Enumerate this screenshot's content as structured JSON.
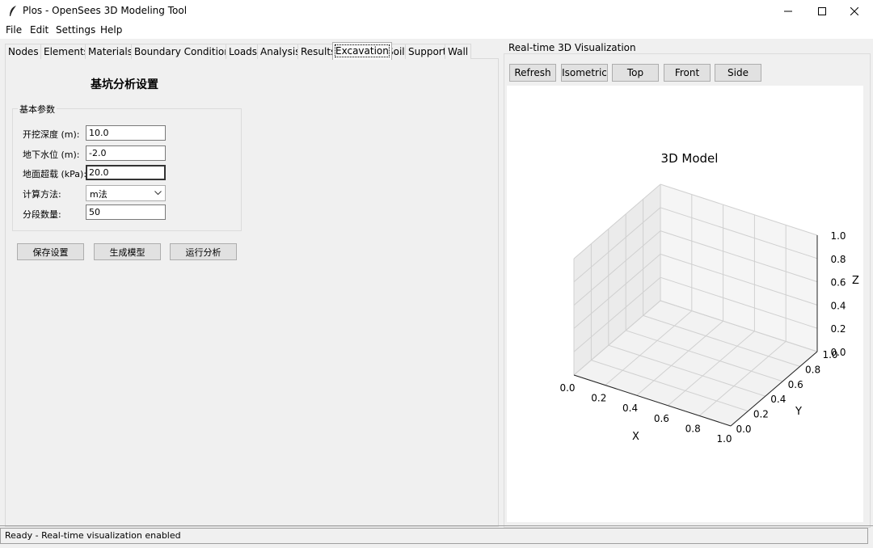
{
  "window": {
    "title": "Plos - OpenSees 3D Modeling Tool",
    "minimize": "–",
    "maximize": "□",
    "close": "✕"
  },
  "menu": [
    "File",
    "Edit",
    "Settings",
    "Help"
  ],
  "tabs": [
    "Nodes",
    "Elements",
    "Materials",
    "Boundary Conditions",
    "Loads",
    "Analysis",
    "Results",
    "Excavation",
    "Soil",
    "Support",
    "Wall"
  ],
  "active_tab": "Excavation",
  "excavation": {
    "heading": "基坑分析设置",
    "group_title": "基本参数",
    "params": [
      {
        "label": "开挖深度 (m):",
        "value": "10.0"
      },
      {
        "label": "地下水位 (m):",
        "value": "-2.0"
      },
      {
        "label": "地面超载 (kPa):",
        "value": "20.0"
      }
    ],
    "method_label": "计算方法:",
    "method_value": "m法",
    "segments_label": "分段数量:",
    "segments_value": "50",
    "buttons": {
      "save": "保存设置",
      "generate": "生成模型",
      "run": "运行分析"
    }
  },
  "visualization": {
    "frame_title": "Real-time 3D Visualization",
    "buttons": [
      "Refresh",
      "Isometric",
      "Top",
      "Front",
      "Side"
    ]
  },
  "chart_data": {
    "type": "scatter",
    "title": "3D Model",
    "xlabel": "X",
    "ylabel": "Y",
    "zlabel": "Z",
    "xlim": [
      0.0,
      1.0
    ],
    "ylim": [
      0.0,
      1.0
    ],
    "zlim": [
      0.0,
      1.0
    ],
    "x_ticks": [
      "0.0",
      "0.2",
      "0.4",
      "0.6",
      "0.8",
      "1.0"
    ],
    "y_ticks": [
      "0.0",
      "0.2",
      "0.4",
      "0.6",
      "0.8",
      "1.0"
    ],
    "z_ticks": [
      "0.0",
      "0.2",
      "0.4",
      "0.6",
      "0.8",
      "1.0"
    ],
    "points": [],
    "grid": true
  },
  "status": "Ready - Real-time visualization enabled"
}
